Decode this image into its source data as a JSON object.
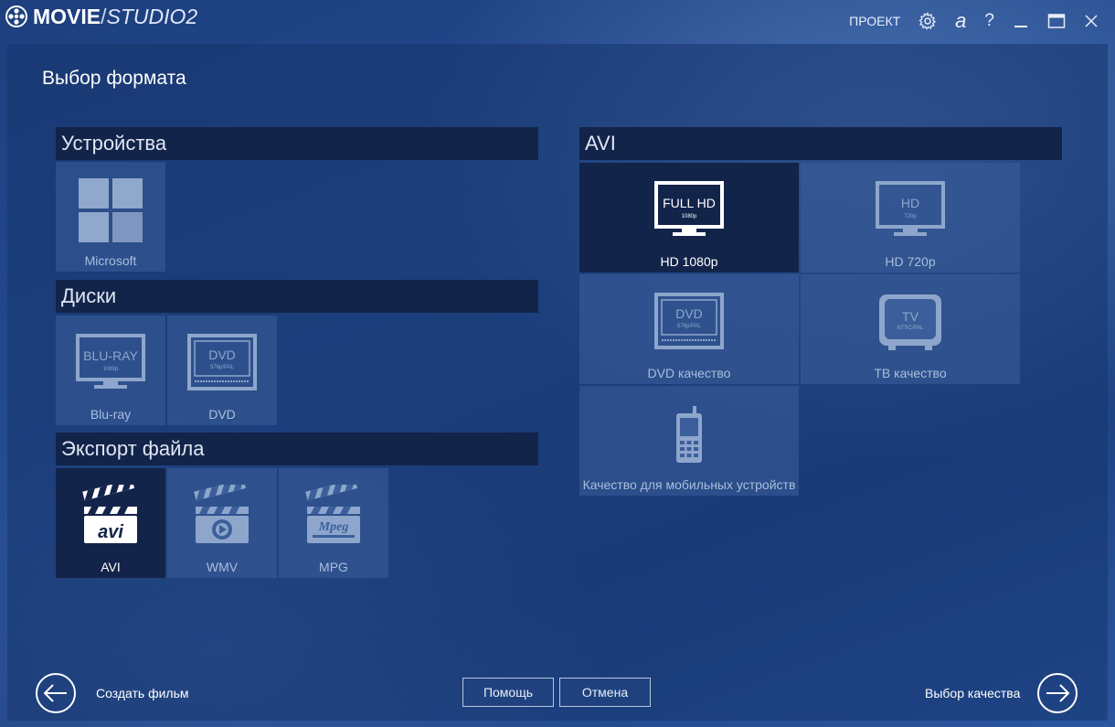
{
  "app": {
    "logo_bold": "MOVIE",
    "logo_light": "STUDIO2"
  },
  "titlebar": {
    "project_label": "ПРОЕКТ",
    "font_label": "a",
    "help_label": "?"
  },
  "page": {
    "title": "Выбор формата"
  },
  "sections": {
    "devices": {
      "title": "Устройства",
      "items": [
        {
          "label": "Microsoft"
        }
      ]
    },
    "discs": {
      "title": "Диски",
      "items": [
        {
          "label": "Blu-ray",
          "screen_text": "BLU-RAY",
          "screen_sub": "1080p"
        },
        {
          "label": "DVD",
          "screen_text": "DVD",
          "screen_sub": "576p/PAL"
        }
      ]
    },
    "export": {
      "title": "Экспорт файла",
      "items": [
        {
          "label": "AVI",
          "selected": true
        },
        {
          "label": "WMV"
        },
        {
          "label": "MPG"
        }
      ]
    },
    "avi": {
      "title": "AVI",
      "items": [
        {
          "label": "HD 1080p",
          "screen_text": "FULL HD",
          "screen_sub": "1080p",
          "selected": true
        },
        {
          "label": "HD 720p",
          "screen_text": "HD",
          "screen_sub": "720p"
        },
        {
          "label": "DVD качество",
          "screen_text": "DVD",
          "screen_sub": "576p/PAL"
        },
        {
          "label": "ТВ качество",
          "screen_text": "TV",
          "screen_sub": "NTSC/PAL"
        },
        {
          "label": "Качество для мобильных устройств"
        }
      ]
    }
  },
  "footer": {
    "back_label": "Создать фильм",
    "help_button": "Помощь",
    "cancel_button": "Отмена",
    "next_label": "Выбор качества"
  },
  "icons": {
    "logo": "film-reel-icon",
    "settings": "gear-icon",
    "font": "font-icon",
    "help": "help-icon",
    "minimize": "minimize-icon",
    "maximize": "maximize-icon",
    "close": "close-icon",
    "back": "arrow-left-icon",
    "next": "arrow-right-icon"
  },
  "colors": {
    "background": "#1c3e7c",
    "section_header": "#13244a",
    "tile": "#3c5f9b",
    "tile_selected": "#13244a",
    "tile_label_dim": "#a9bedd"
  }
}
